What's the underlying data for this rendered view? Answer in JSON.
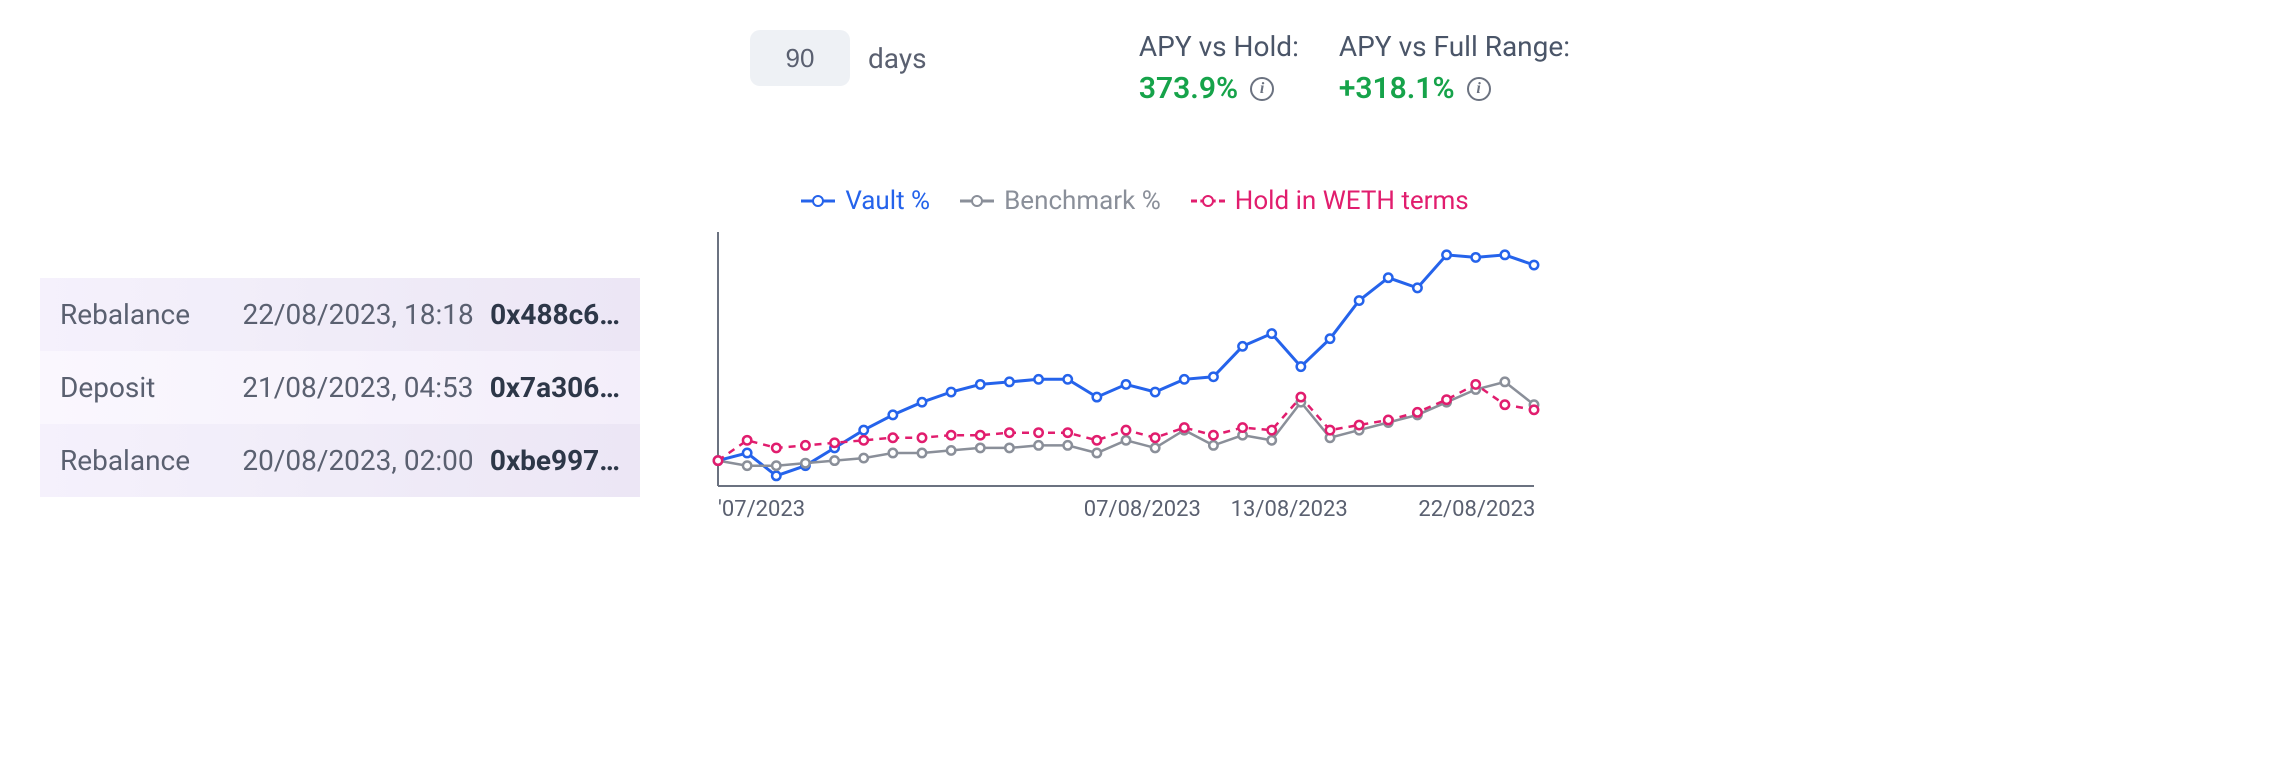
{
  "transactions": [
    {
      "type": "Rebalance",
      "date": "22/08/2023, 18:18",
      "hash": "0x488c6…"
    },
    {
      "type": "Deposit",
      "date": "21/08/2023, 04:53",
      "hash": "0x7a306…"
    },
    {
      "type": "Rebalance",
      "date": "20/08/2023, 02:00",
      "hash": "0xbe997…"
    }
  ],
  "days_input": {
    "value": "90",
    "unit_label": "days"
  },
  "metrics": {
    "apy_vs_hold": {
      "label": "APY vs Hold:",
      "value": "373.9%"
    },
    "apy_vs_fullrange": {
      "label": "APY vs Full Range:",
      "value": "+318.1%"
    }
  },
  "legend": {
    "vault": {
      "label": "Vault %",
      "color": "#2563eb"
    },
    "benchmark": {
      "label": "Benchmark %",
      "color": "#8a8f99"
    },
    "hold": {
      "label": "Hold in WETH terms",
      "color": "#e11d6e"
    }
  },
  "chart_data": {
    "type": "line",
    "xticks": [
      "'07/2023",
      "07/08/2023",
      "13/08/2023",
      "22/08/2023"
    ],
    "series": [
      {
        "name": "Vault %",
        "color": "#2563eb",
        "style": "solid",
        "values": [
          0,
          3,
          -6,
          -2,
          5,
          12,
          18,
          23,
          27,
          30,
          31,
          32,
          32,
          25,
          30,
          27,
          32,
          33,
          45,
          50,
          37,
          48,
          63,
          72,
          68,
          81,
          80,
          81,
          77
        ]
      },
      {
        "name": "Benchmark %",
        "color": "#8a8f99",
        "style": "solid",
        "values": [
          0,
          -2,
          -2,
          -1,
          0,
          1,
          3,
          3,
          4,
          5,
          5,
          6,
          6,
          3,
          8,
          5,
          12,
          6,
          10,
          8,
          23,
          9,
          12,
          15,
          18,
          23,
          28,
          31,
          22
        ]
      },
      {
        "name": "Hold in WETH terms",
        "color": "#e11d6e",
        "style": "dashed",
        "values": [
          0,
          8,
          5,
          6,
          7,
          8,
          9,
          9,
          10,
          10,
          11,
          11,
          11,
          8,
          12,
          9,
          13,
          10,
          13,
          12,
          25,
          12,
          14,
          16,
          19,
          24,
          30,
          22,
          20
        ]
      }
    ],
    "ylim": [
      -10,
      90
    ],
    "ylabel": "",
    "xlabel": "",
    "title": ""
  }
}
